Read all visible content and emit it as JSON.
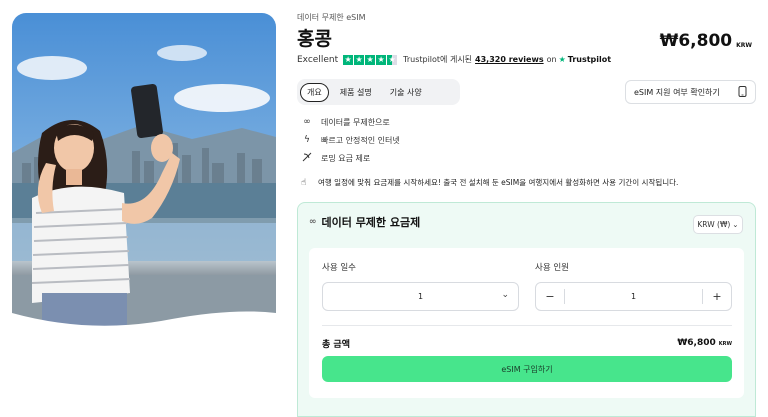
{
  "product": {
    "breadcrumb": "데이터 무제한 eSIM",
    "title": "홍콩",
    "price": "₩6,800",
    "price_currency": "KRW"
  },
  "rating": {
    "label": "Excellent",
    "stars": 4.5,
    "posted_text": "Trustpilot에 게시된",
    "reviews": "43,320 reviews",
    "on_text": "on",
    "brand": "Trustpilot",
    "star_color": "#00b67a"
  },
  "tabs": [
    {
      "label": "개요",
      "active": true
    },
    {
      "label": "제품 설명",
      "active": false
    },
    {
      "label": "기술 사양",
      "active": false
    }
  ],
  "compat_button": {
    "label": "eSIM 지원 여부 확인하기",
    "icon": "phone-check-icon"
  },
  "features": [
    {
      "icon": "infinity-icon",
      "text": "데이터를 무제한으로"
    },
    {
      "icon": "lightning-icon",
      "text": "빠르고 안정적인 인터넷"
    },
    {
      "icon": "no-roaming-icon",
      "text": "로밍 요금 제로"
    }
  ],
  "notice": "여행 일정에 맞춰 요금제를 시작하세요! 출국 전 설치해 둔 eSIM을 여행지에서 활성화하면 사용 기간이 시작됩니다.",
  "plan": {
    "title": "데이터 무제한 요금제",
    "currency_select": "KRW (₩)",
    "days_label": "사용 일수",
    "days_value": "1",
    "people_label": "사용 인원",
    "people_value": "1",
    "minus": "−",
    "plus": "+",
    "total_label": "총 금액",
    "total_amount": "₩6,800",
    "total_currency": "KRW",
    "buy_label": "eSIM 구입하기",
    "accent_color": "#47e58c",
    "panel_color": "#eefaf5"
  }
}
